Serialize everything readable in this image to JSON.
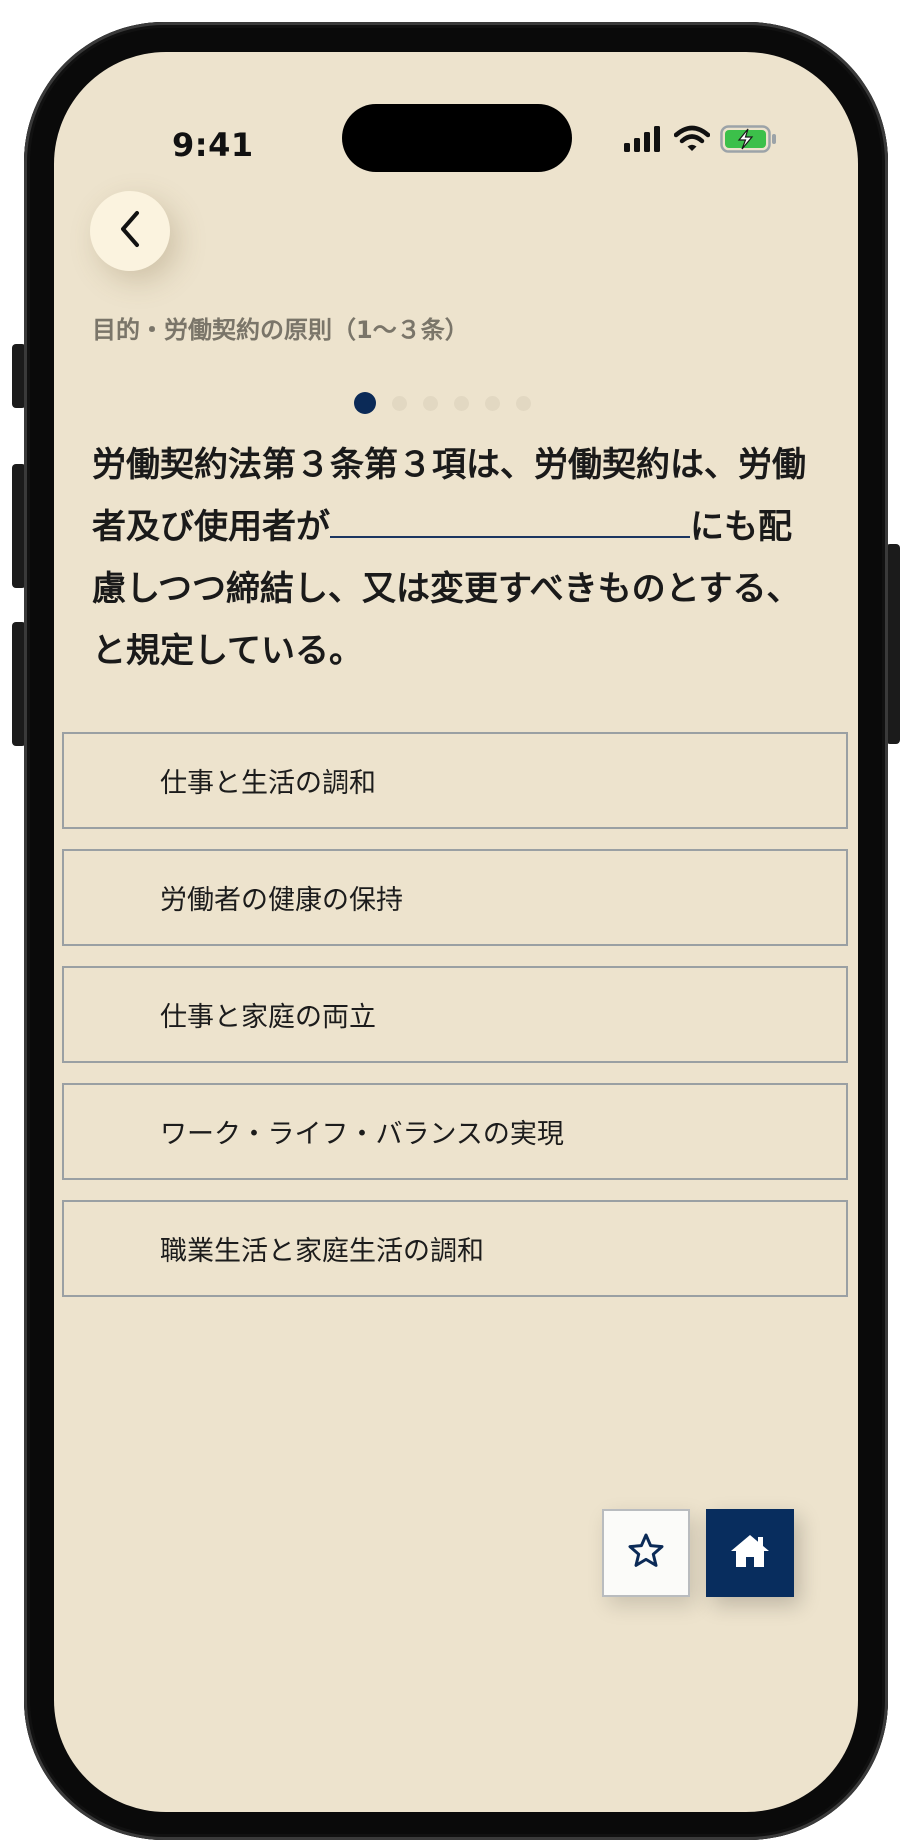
{
  "status_bar": {
    "time": "9:41",
    "icons": [
      "cellular-signal-icon",
      "wifi-icon",
      "battery-charging-icon"
    ],
    "battery_color": "#3cc04a"
  },
  "nav": {
    "back_icon": "chevron-left-icon",
    "breadcrumb": "目的・労働契約の原則（1〜３条）"
  },
  "progress": {
    "total": 6,
    "current": 1,
    "active_color": "#0b2a57"
  },
  "question": {
    "part1": "労働契約法第３条第３項は、労働契約は、労働者及び使用者が",
    "part2": "にも配慮しつつ締結し、又は変更すべきものとする、と規定している。"
  },
  "options": [
    {
      "label": "仕事と生活の調和"
    },
    {
      "label": "労働者の健康の保持"
    },
    {
      "label": "仕事と家庭の両立"
    },
    {
      "label": "ワーク・ライフ・バランスの実現"
    },
    {
      "label": "職業生活と家庭生活の調和"
    }
  ],
  "actions": {
    "favorite_icon": "star-outline-icon",
    "home_icon": "home-icon",
    "accent_color": "#082d5e"
  }
}
